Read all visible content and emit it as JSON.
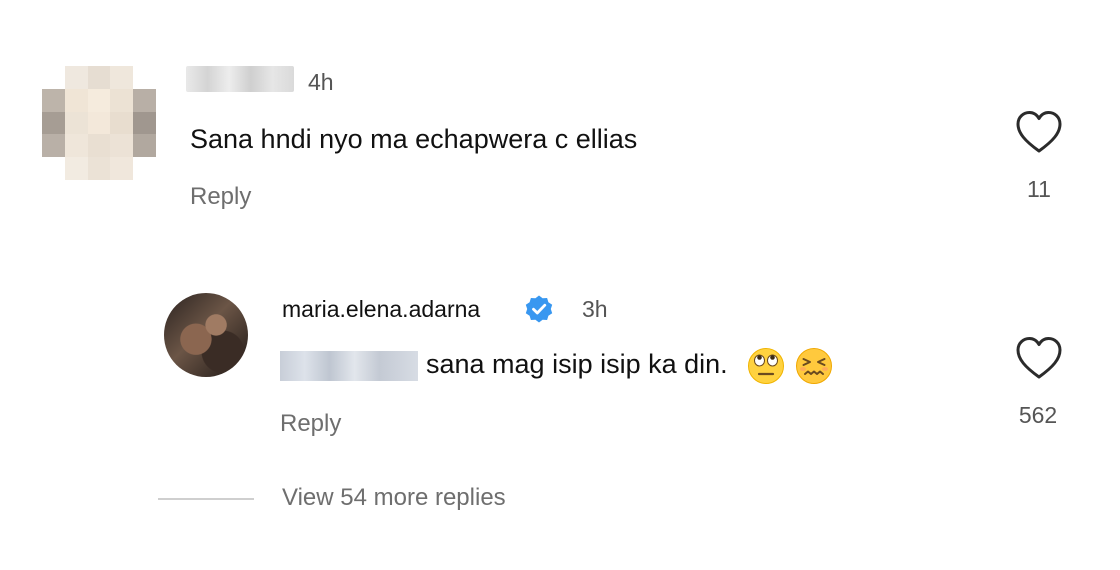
{
  "comments": [
    {
      "time": "4h",
      "text": "Sana hndi nyo ma echapwera c ellias",
      "reply_label": "Reply",
      "like_count": "11",
      "avatar_icon": "pixelated-avatar"
    }
  ],
  "reply": {
    "username": "maria.elena.adarna",
    "verified_icon": "verified-badge-icon",
    "time": "3h",
    "text": "sana mag isip isip ka din.",
    "emojis": [
      "face-with-rolling-eyes-emoji",
      "confounded-face-emoji"
    ],
    "reply_label": "Reply",
    "like_count": "562"
  },
  "view_more": "View 54 more replies",
  "colors": {
    "verified_blue": "#3897f0",
    "secondary_text": "#6e6e6e"
  }
}
